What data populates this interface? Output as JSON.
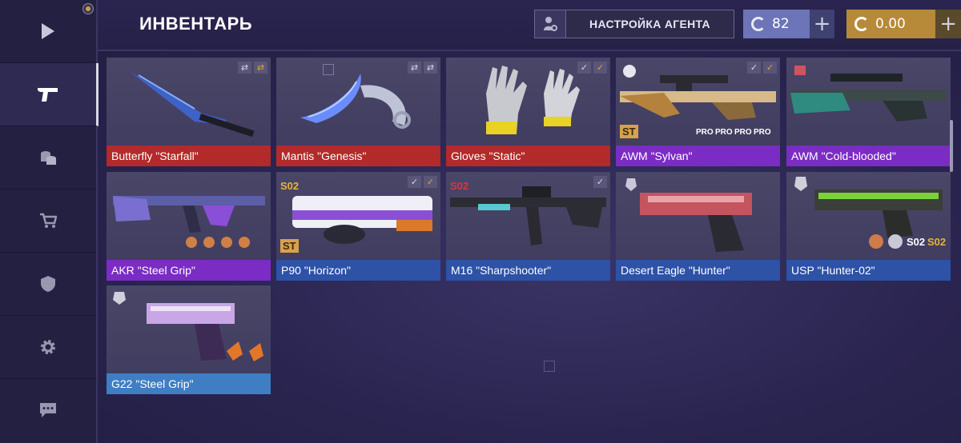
{
  "header": {
    "title": "ИНВЕНТАРЬ",
    "agent_button": "НАСТРОЙКА АГЕНТА",
    "currency_silver": "82",
    "currency_gold": "0.00",
    "plus": "+"
  },
  "sidebar": [
    {
      "icon": "play-icon"
    },
    {
      "icon": "pistol-icon"
    },
    {
      "icon": "coins-icon"
    },
    {
      "icon": "cart-icon"
    },
    {
      "icon": "shield-icon"
    },
    {
      "icon": "gear-icon"
    },
    {
      "icon": "chat-icon"
    }
  ],
  "items": [
    {
      "name": "Butterfly \"Starfall\"",
      "rarity": "#b22a2a"
    },
    {
      "name": "Mantis \"Genesis\"",
      "rarity": "#b22a2a"
    },
    {
      "name": "Gloves \"Static\"",
      "rarity": "#b22a2a"
    },
    {
      "name": "AWM \"Sylvan\"",
      "rarity": "#7b2cc4",
      "badge": "ST",
      "pro": "PRO"
    },
    {
      "name": "AWM \"Cold-blooded\"",
      "rarity": "#7b2cc4"
    },
    {
      "name": "AKR \"Steel Grip\"",
      "rarity": "#7b2cc4"
    },
    {
      "name": "P90 \"Horizon\"",
      "rarity": "#2d52a6",
      "badge_top": "S02",
      "badge": "ST"
    },
    {
      "name": "M16 \"Sharpshooter\"",
      "rarity": "#2d52a6",
      "badge_top": "S02"
    },
    {
      "name": "Desert Eagle \"Hunter\"",
      "rarity": "#2d52a6"
    },
    {
      "name": "USP \"Hunter-02\"",
      "rarity": "#2d52a6",
      "badge_a": "S02",
      "badge_b": "S02"
    },
    {
      "name": "G22 \"Steel Grip\"",
      "rarity": "#3f7ec3"
    }
  ]
}
